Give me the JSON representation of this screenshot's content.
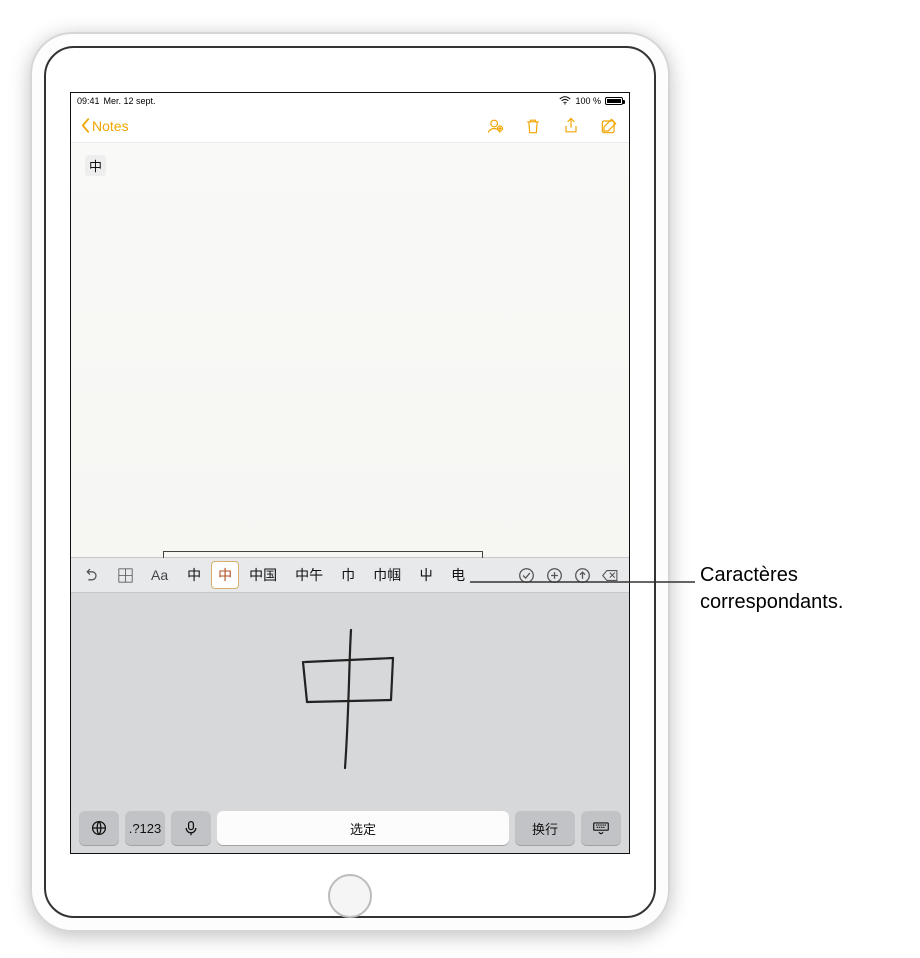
{
  "status": {
    "time": "09:41",
    "date": "Mer. 12 sept.",
    "battery_text": "100 %"
  },
  "nav": {
    "back_label": "Notes"
  },
  "note": {
    "typed_char": "中"
  },
  "candidates": {
    "items": [
      "中",
      "中",
      "中国",
      "中午",
      "巾",
      "巾帼",
      "屮",
      "电"
    ],
    "highlight_index": 1
  },
  "keyboard": {
    "numbers_label": ".?123",
    "space_label": "选定",
    "return_label": "换行"
  },
  "callout": {
    "line1": "Caractères",
    "line2": "correspondants."
  }
}
